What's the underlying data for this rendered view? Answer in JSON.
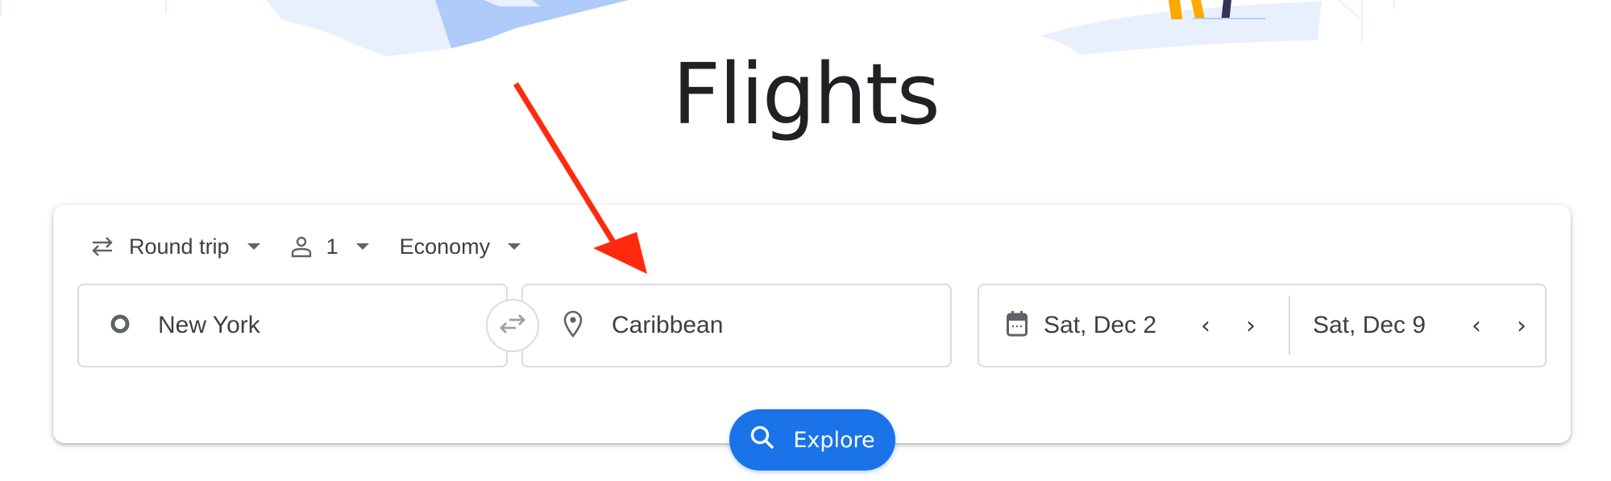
{
  "page": {
    "title": "Flights"
  },
  "colors": {
    "accent": "#1a73e8",
    "annotation_arrow": "#ff2a0d",
    "text": "#3c4043",
    "title": "#202124"
  },
  "options": {
    "trip_type": {
      "label": "Round trip",
      "icon": "swap-arrows-icon"
    },
    "passengers": {
      "label": "1",
      "icon": "person-icon"
    },
    "cabin_class": {
      "label": "Economy"
    }
  },
  "search": {
    "origin": {
      "value": "New York",
      "icon": "circle-icon"
    },
    "destination": {
      "value": "Caribbean",
      "icon": "location-pin-icon"
    },
    "swap_icon": "swap-icon",
    "departure": {
      "value": "Sat, Dec 2",
      "icon": "calendar-icon"
    },
    "return": {
      "value": "Sat, Dec 9"
    },
    "prev_label": "‹",
    "next_label": "›"
  },
  "explore_button": {
    "label": "Explore",
    "icon": "search-icon"
  },
  "annotation": {
    "type": "arrow",
    "target": "destination-field"
  }
}
